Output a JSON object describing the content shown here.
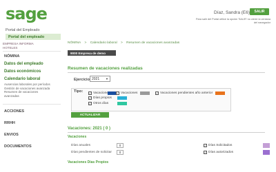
{
  "header": {
    "logo_text": "sage",
    "portal_title": "Portal del Empleado",
    "portal_sub": "Portal del empleado",
    "company_lines": [
      "EMPRESA INFORMA",
      "HOTELES"
    ],
    "user_name": "Díaz, Sandra (E6)",
    "salir_label": "SALIR",
    "logout_note": "Para salir del Portal utilice la opción 'SALIR' no cierre la ventana del navegador"
  },
  "sidebar": {
    "nomina_label": "NÓMINA",
    "items": [
      {
        "label": "Datos del empleado"
      },
      {
        "label": "Datos económicos"
      },
      {
        "label": "Calendario laboral"
      }
    ],
    "subitems": [
      "Ausencias laborales por períodos",
      "Gestión de vacaciones avanzada",
      "Resumen de vacaciones avanzadas"
    ],
    "groups": [
      "ACCIONES",
      "RRHH",
      "ENVIOS",
      "DOCUMENTOS"
    ]
  },
  "breadcrumb": [
    "NÓMINA",
    ">",
    "Calendario laboral",
    ">",
    "Resumen de vacaciones avanzadas"
  ],
  "company_banner": "9000 Empresa de demo",
  "summary": {
    "title": "Resumen de vacaciones realizadas",
    "ejercicio_label": "Ejercicio:",
    "ejercicio_value": "2021",
    "tipo_label": "Tipo:",
    "types": [
      {
        "label": "Vacaciones",
        "color": "#1a4fa0"
      },
      {
        "label": "Vacaciones",
        "color": "#9a9a9a"
      },
      {
        "label": "Vacaciones pendientes año anterior",
        "color": "#e8731c"
      },
      {
        "label": "Días propios",
        "color": "#29b0d6"
      },
      {
        "label": "Otros días",
        "color": "#2fc7a0"
      }
    ],
    "actualizar_label": "ACTUALIZAR"
  },
  "vacaciones": {
    "title": "Vacaciones: 2021 ( 0 )",
    "sub": "Vacaciones",
    "rows": [
      {
        "label": "Días anuales",
        "value": "0"
      },
      {
        "label": "Días pendientes de solicitar",
        "value": "0"
      }
    ],
    "right_rows": [
      {
        "label": "Días Solicitados",
        "color": "#c49fd6"
      },
      {
        "label": "Días autorizados",
        "color": "#9b6fd0"
      }
    ],
    "dias_propios_title": "Vacaciones Días Propios"
  }
}
